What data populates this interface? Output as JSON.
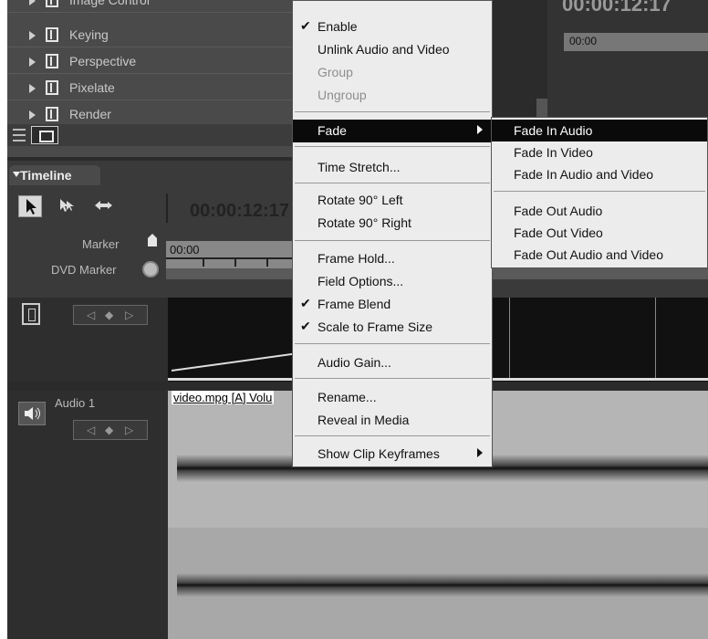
{
  "effects": {
    "items": [
      "Image Control",
      "Keying",
      "Perspective",
      "Pixelate",
      "Render"
    ]
  },
  "monitor": {
    "timecode": "00:00:12:17",
    "ruler_time": "00:00"
  },
  "timeline": {
    "tab": "Timeline",
    "timecode": "00:00:12:17",
    "marker_label": "Marker",
    "dvd_marker_label": "DVD Marker",
    "ruler_time": "00:00",
    "audio_track_name": "Audio 1",
    "audio_clip_title": "video.mpg [A] Volu"
  },
  "context_menu": {
    "items": [
      {
        "label": "Enable",
        "checked": true
      },
      {
        "label": "Unlink Audio and Video"
      },
      {
        "label": "Group",
        "disabled": true
      },
      {
        "label": "Ungroup",
        "disabled": true
      },
      {
        "label": "Fade",
        "submenu": true,
        "selected": true
      },
      {
        "label": "Time Stretch..."
      },
      {
        "label": "Rotate 90° Left"
      },
      {
        "label": "Rotate 90° Right"
      },
      {
        "label": "Frame Hold..."
      },
      {
        "label": "Field Options..."
      },
      {
        "label": "Frame Blend",
        "checked": true
      },
      {
        "label": "Scale to Frame Size",
        "checked": true
      },
      {
        "label": "Audio Gain..."
      },
      {
        "label": "Rename..."
      },
      {
        "label": "Reveal in Media"
      },
      {
        "label": "Show Clip Keyframes",
        "submenu": true
      }
    ]
  },
  "fade_submenu": {
    "items": [
      "Fade In Audio",
      "Fade In Video",
      "Fade In Audio and Video",
      "Fade Out Audio",
      "Fade Out Video",
      "Fade Out Audio and Video"
    ]
  },
  "check_mark": "✔",
  "keyframe_nav": [
    "◁",
    "◆",
    "▷"
  ]
}
